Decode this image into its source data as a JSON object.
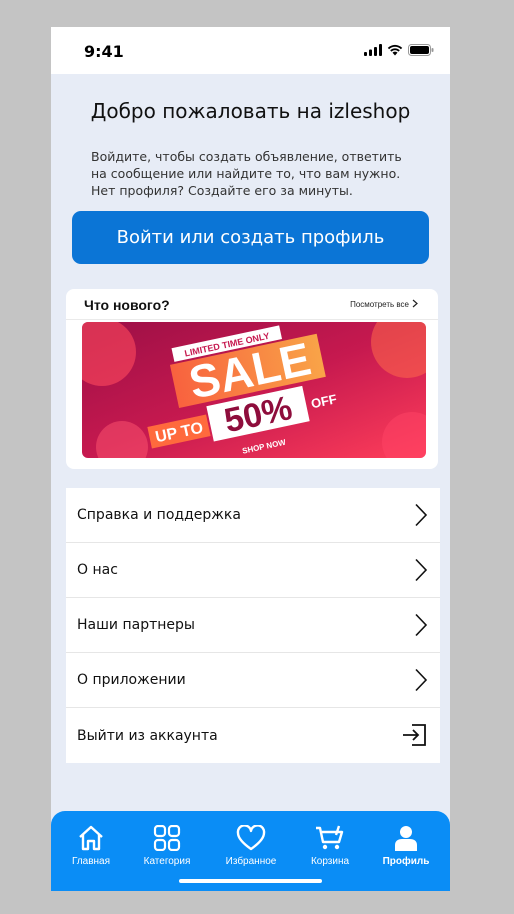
{
  "status_bar": {
    "time": "9:41"
  },
  "welcome": {
    "title": "Добро пожаловать на izleshop",
    "text": "Войдите, чтобы создать объявление, ответить на сообщение или найдите то, что вам нужно. Нет профиля? Создайте его за минуты.",
    "button_label": "Войти или создать профиль"
  },
  "news": {
    "title": "Что нового?",
    "see_all": "Посмотреть все",
    "banner": {
      "tag": "LIMITED TIME ONLY",
      "headline": "SALE",
      "up_to": "UP TO",
      "percent": "50%",
      "off": "OFF",
      "cta": "SHOP NOW"
    }
  },
  "menu": {
    "items": [
      {
        "label": "Справка и поддержка",
        "icon": "chevron-right-icon"
      },
      {
        "label": "О нас",
        "icon": "chevron-right-icon"
      },
      {
        "label": "Наши партнеры",
        "icon": "chevron-right-icon"
      },
      {
        "label": "О приложении",
        "icon": "chevron-right-icon"
      },
      {
        "label": "Выйти из аккаунта",
        "icon": "logout-icon"
      }
    ]
  },
  "tabbar": {
    "tabs": [
      {
        "label": "Главная",
        "icon": "home-icon"
      },
      {
        "label": "Категория",
        "icon": "grid-icon"
      },
      {
        "label": "Избранное",
        "icon": "heart-icon"
      },
      {
        "label": "Корзина",
        "icon": "cart-icon"
      },
      {
        "label": "Профиль",
        "icon": "profile-icon",
        "active": true
      }
    ]
  },
  "colors": {
    "primary_button": "#0b75d6",
    "tabbar": "#0a8df6",
    "background": "#e7ecf6",
    "banner_gradient_start": "#b3124f",
    "banner_gradient_end": "#ff3d57"
  }
}
